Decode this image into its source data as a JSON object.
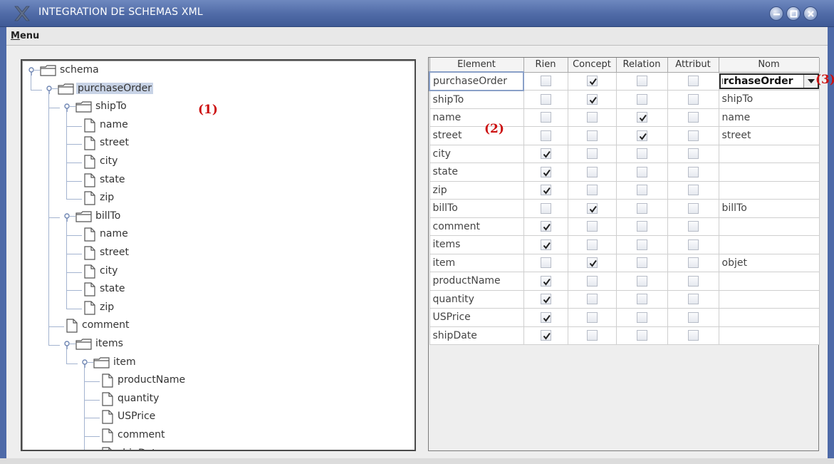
{
  "window": {
    "title": "INTEGRATION DE SCHEMAS XML"
  },
  "menubar": {
    "menu_label_first": "M",
    "menu_label_rest": "enu"
  },
  "annotations": {
    "tree": "(1)",
    "table": "(2)",
    "combo": "(3)"
  },
  "tree": {
    "nodes": [
      {
        "label": "schema",
        "type": "folder",
        "level": 0
      },
      {
        "label": "purchaseOrder",
        "type": "folder",
        "level": 1,
        "selected": true
      },
      {
        "label": "shipTo",
        "type": "folder",
        "level": 2
      },
      {
        "label": "name",
        "type": "leaf",
        "level": 3
      },
      {
        "label": "street",
        "type": "leaf",
        "level": 3
      },
      {
        "label": "city",
        "type": "leaf",
        "level": 3
      },
      {
        "label": "state",
        "type": "leaf",
        "level": 3
      },
      {
        "label": "zip",
        "type": "leaf",
        "level": 3
      },
      {
        "label": "billTo",
        "type": "folder",
        "level": 2
      },
      {
        "label": "name",
        "type": "leaf",
        "level": 3
      },
      {
        "label": "street",
        "type": "leaf",
        "level": 3
      },
      {
        "label": "city",
        "type": "leaf",
        "level": 3
      },
      {
        "label": "state",
        "type": "leaf",
        "level": 3
      },
      {
        "label": "zip",
        "type": "leaf",
        "level": 3
      },
      {
        "label": "comment",
        "type": "leaf",
        "level": 2
      },
      {
        "label": "items",
        "type": "folder",
        "level": 2
      },
      {
        "label": "item",
        "type": "folder",
        "level": 3
      },
      {
        "label": "productName",
        "type": "leaf",
        "level": 4
      },
      {
        "label": "quantity",
        "type": "leaf",
        "level": 4
      },
      {
        "label": "USPrice",
        "type": "leaf",
        "level": 4
      },
      {
        "label": "comment",
        "type": "leaf",
        "level": 4
      },
      {
        "label": "shipDate",
        "type": "leaf",
        "level": 4
      }
    ]
  },
  "table": {
    "columns": [
      "Element",
      "Rien",
      "Concept",
      "Relation",
      "Attribut",
      "Nom"
    ],
    "rows": [
      {
        "element": "purchaseOrder",
        "rien": false,
        "concept": true,
        "relation": false,
        "attribut": false,
        "nom": "purchaseOrder",
        "editing": true
      },
      {
        "element": "shipTo",
        "rien": false,
        "concept": true,
        "relation": false,
        "attribut": false,
        "nom": "shipTo"
      },
      {
        "element": "name",
        "rien": false,
        "concept": false,
        "relation": true,
        "attribut": false,
        "nom": "name"
      },
      {
        "element": "street",
        "rien": false,
        "concept": false,
        "relation": true,
        "attribut": false,
        "nom": "street"
      },
      {
        "element": "city",
        "rien": true,
        "concept": false,
        "relation": false,
        "attribut": false,
        "nom": ""
      },
      {
        "element": "state",
        "rien": true,
        "concept": false,
        "relation": false,
        "attribut": false,
        "nom": ""
      },
      {
        "element": "zip",
        "rien": true,
        "concept": false,
        "relation": false,
        "attribut": false,
        "nom": ""
      },
      {
        "element": "billTo",
        "rien": false,
        "concept": true,
        "relation": false,
        "attribut": false,
        "nom": "billTo"
      },
      {
        "element": "comment",
        "rien": true,
        "concept": false,
        "relation": false,
        "attribut": false,
        "nom": ""
      },
      {
        "element": "items",
        "rien": true,
        "concept": false,
        "relation": false,
        "attribut": false,
        "nom": ""
      },
      {
        "element": "item",
        "rien": false,
        "concept": true,
        "relation": false,
        "attribut": false,
        "nom": "objet"
      },
      {
        "element": "productName",
        "rien": true,
        "concept": false,
        "relation": false,
        "attribut": false,
        "nom": ""
      },
      {
        "element": "quantity",
        "rien": true,
        "concept": false,
        "relation": false,
        "attribut": false,
        "nom": ""
      },
      {
        "element": "USPrice",
        "rien": true,
        "concept": false,
        "relation": false,
        "attribut": false,
        "nom": ""
      },
      {
        "element": "shipDate",
        "rien": true,
        "concept": false,
        "relation": false,
        "attribut": false,
        "nom": ""
      }
    ]
  },
  "icons": {
    "window_logo": "x-logo-icon",
    "minimize": "minimize-icon",
    "maximize": "maximize-icon",
    "close": "close-icon",
    "folder": "folder-icon",
    "document": "document-icon",
    "toggle": "tree-toggle-icon",
    "check": "check-icon",
    "dropdown": "chevron-down-icon"
  },
  "colors": {
    "titlebar": "#4f6aa6",
    "selection": "#c8d3e6",
    "annotation": "#cc1111"
  }
}
